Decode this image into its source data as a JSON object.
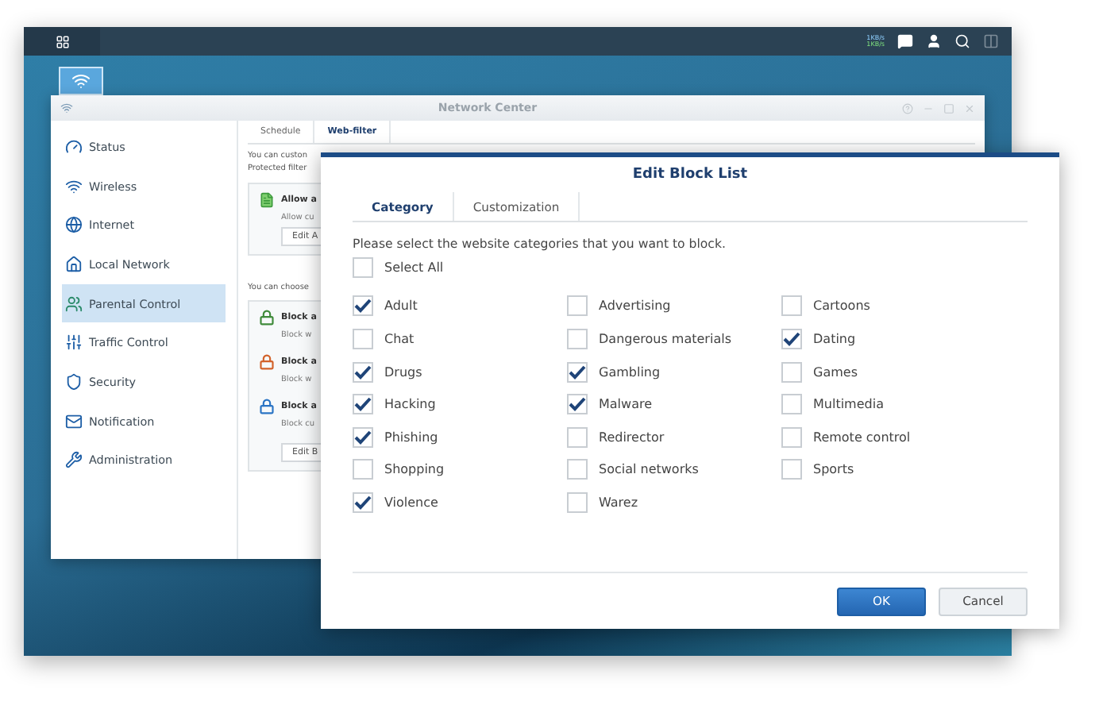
{
  "taskbar": {
    "network_speed": [
      "1KB/s",
      "1KB/s"
    ]
  },
  "window": {
    "title": "Network Center",
    "sidebar": {
      "items": [
        {
          "label": "Status",
          "selected": false
        },
        {
          "label": "Wireless",
          "selected": false
        },
        {
          "label": "Internet",
          "selected": false
        },
        {
          "label": "Local Network",
          "selected": false
        },
        {
          "label": "Parental Control",
          "selected": true
        },
        {
          "label": "Traffic Control",
          "selected": false
        },
        {
          "label": "Security",
          "selected": false
        },
        {
          "label": "Notification",
          "selected": false
        },
        {
          "label": "Administration",
          "selected": false
        }
      ]
    },
    "tabs": [
      {
        "label": "Schedule",
        "selected": false
      },
      {
        "label": "Web-filter",
        "selected": true
      }
    ],
    "intro": [
      "You can custon",
      "Protected filter"
    ],
    "allow_card": {
      "title": "Allow a",
      "text": "Allow cu",
      "button": "Edit A"
    },
    "choose_text": "You can choose",
    "block_card": {
      "items": [
        {
          "title": "Block a",
          "text": "Block w",
          "color": "#3f8a3a"
        },
        {
          "title": "Block a",
          "text": "Block w",
          "color": "#d2622a"
        },
        {
          "title": "Block a",
          "text": "Block cu",
          "color": "#2a74c4"
        }
      ],
      "button": "Edit B"
    }
  },
  "dialog": {
    "title": "Edit Block List",
    "tabs": [
      {
        "label": "Category",
        "selected": true
      },
      {
        "label": "Customization",
        "selected": false
      }
    ],
    "instruction": "Please select the website categories that you want to block.",
    "select_all": {
      "label": "Select All",
      "checked": false
    },
    "categories": [
      {
        "label": "Adult",
        "checked": true
      },
      {
        "label": "Advertising",
        "checked": false
      },
      {
        "label": "Cartoons",
        "checked": false
      },
      {
        "label": "Chat",
        "checked": false
      },
      {
        "label": "Dangerous materials",
        "checked": false
      },
      {
        "label": "Dating",
        "checked": true
      },
      {
        "label": "Drugs",
        "checked": true
      },
      {
        "label": "Gambling",
        "checked": true
      },
      {
        "label": "Games",
        "checked": false
      },
      {
        "label": "Hacking",
        "checked": true
      },
      {
        "label": "Malware",
        "checked": true
      },
      {
        "label": "Multimedia",
        "checked": false
      },
      {
        "label": "Phishing",
        "checked": true
      },
      {
        "label": "Redirector",
        "checked": false
      },
      {
        "label": "Remote control",
        "checked": false
      },
      {
        "label": "Shopping",
        "checked": false
      },
      {
        "label": "Social networks",
        "checked": false
      },
      {
        "label": "Sports",
        "checked": false
      },
      {
        "label": "Violence",
        "checked": true
      },
      {
        "label": "Warez",
        "checked": false
      }
    ],
    "buttons": [
      {
        "label": "OK",
        "kind": "primary"
      },
      {
        "label": "Cancel",
        "kind": "secondary"
      }
    ]
  }
}
